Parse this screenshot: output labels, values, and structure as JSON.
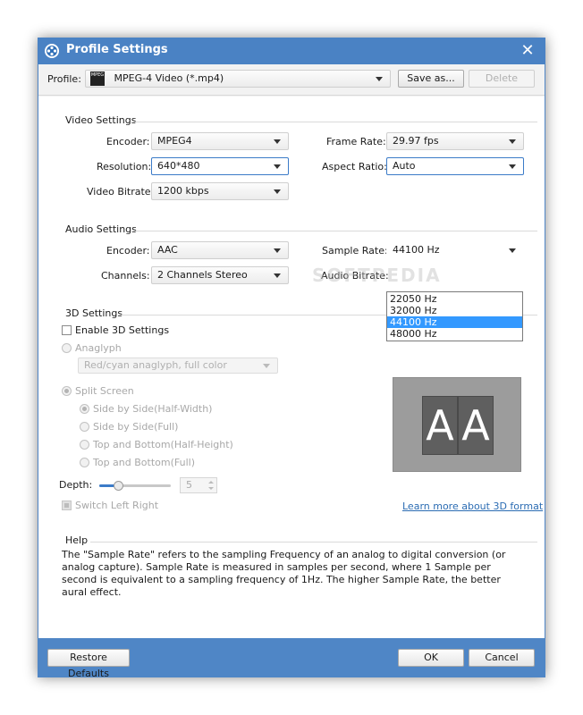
{
  "window": {
    "title": "Profile Settings"
  },
  "profile": {
    "label": "Profile:",
    "value": "MPEG-4 Video (*.mp4)",
    "icon_text": "MPEG",
    "save_as_label": "Save as...",
    "delete_label": "Delete"
  },
  "video": {
    "section_title": "Video Settings",
    "encoder_label": "Encoder:",
    "encoder_value": "MPEG4",
    "resolution_label": "Resolution:",
    "resolution_value": "640*480",
    "bitrate_label": "Video Bitrate:",
    "bitrate_value": "1200 kbps",
    "framerate_label": "Frame Rate:",
    "framerate_value": "29.97 fps",
    "aspect_label": "Aspect Ratio:",
    "aspect_value": "Auto"
  },
  "audio": {
    "section_title": "Audio Settings",
    "encoder_label": "Encoder:",
    "encoder_value": "AAC",
    "channels_label": "Channels:",
    "channels_value": "2 Channels Stereo",
    "samplerate_label": "Sample Rate:",
    "samplerate_value": "44100 Hz",
    "samplerate_options": [
      "22050 Hz",
      "32000 Hz",
      "44100 Hz",
      "48000 Hz"
    ],
    "samplerate_selected_index": 2,
    "bitrate_label": "Audio Bitrate:"
  },
  "three_d": {
    "section_title": "3D Settings",
    "enable_label": "Enable 3D Settings",
    "anaglyph_label": "Anaglyph",
    "anaglyph_mode": "Red/cyan anaglyph, full color",
    "split_screen_label": "Split Screen",
    "split_options": [
      "Side by Side(Half-Width)",
      "Side by Side(Full)",
      "Top and Bottom(Half-Height)",
      "Top and Bottom(Full)"
    ],
    "depth_label": "Depth:",
    "depth_value": "5",
    "depth_level": 0.26,
    "switch_label": "Switch Left Right",
    "learn_more_link": "Learn more about 3D format",
    "preview_letters": [
      "A",
      "A"
    ]
  },
  "help": {
    "section_title": "Help",
    "text": "The \"Sample Rate\" refers to the sampling Frequency of an analog to digital conversion (or analog capture). Sample Rate is measured in samples per second, where 1 Sample per second is equivalent to a sampling frequency of 1Hz. The higher Sample Rate, the better aural effect."
  },
  "footer": {
    "restore_label": "Restore Defaults",
    "ok_label": "OK",
    "cancel_label": "Cancel"
  },
  "watermark": "SOFTPEDIA",
  "colors": {
    "titlebar": "#4a82c4",
    "accent": "#3b7bc8",
    "selection": "#3399ff",
    "link": "#2b6cb3"
  },
  "icons": {
    "app": "film-reel-icon",
    "close": "close-icon",
    "profile_format": "mpeg-file-icon",
    "dropdown": "chevron-down-icon"
  }
}
